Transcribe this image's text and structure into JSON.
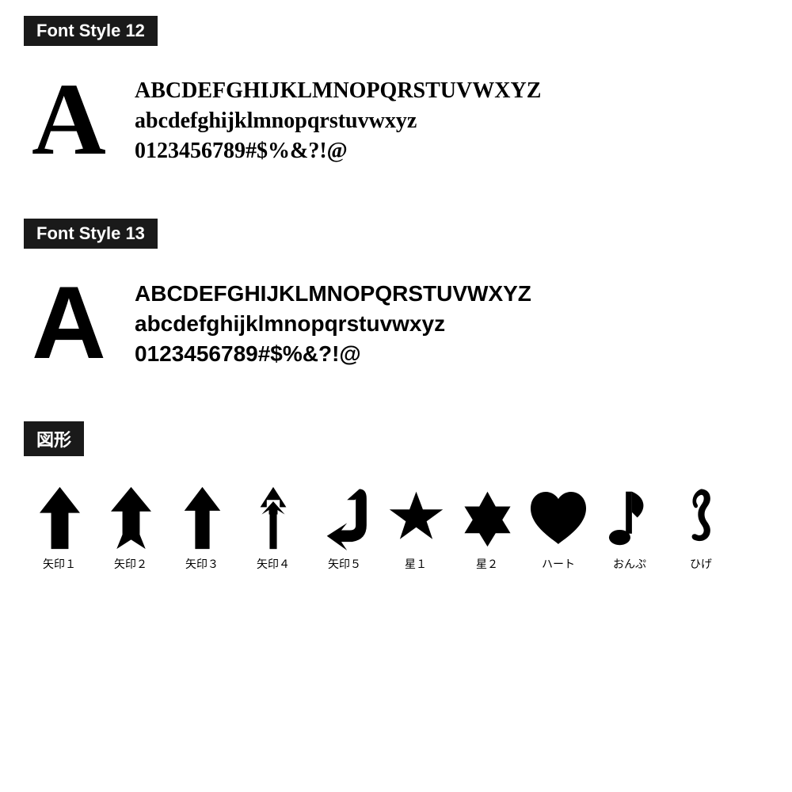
{
  "sections": [
    {
      "id": "font-style-12",
      "label": "Font Style 12",
      "bigLetter": "A",
      "lines": [
        "ABCDEFGHIJKLMNOPQRSTUVWXYZ",
        "abcdefghijklmnopqrstuvwxyz",
        "0123456789#$%&?!@"
      ],
      "fontClass": "font-style-12"
    },
    {
      "id": "font-style-13",
      "label": "Font Style 13",
      "bigLetter": "A",
      "lines": [
        "ABCDEFGHIJKLMNOPQRSTUVWXYZ",
        "abcdefghijklmnopqrstuvwxyz",
        "0123456789#$%&?!@"
      ],
      "fontClass": "font-style-13"
    }
  ],
  "figuresSection": {
    "label": "図形",
    "figures": [
      {
        "id": "arrow1",
        "label": "矢印１",
        "type": "arrow1"
      },
      {
        "id": "arrow2",
        "label": "矢印２",
        "type": "arrow2"
      },
      {
        "id": "arrow3",
        "label": "矢印３",
        "type": "arrow3"
      },
      {
        "id": "arrow4",
        "label": "矢印４",
        "type": "arrow4"
      },
      {
        "id": "arrow5",
        "label": "矢印５",
        "type": "arrow5"
      },
      {
        "id": "star1",
        "label": "星１",
        "type": "star1"
      },
      {
        "id": "star2",
        "label": "星２",
        "type": "star2"
      },
      {
        "id": "heart",
        "label": "ハート",
        "type": "heart"
      },
      {
        "id": "note",
        "label": "おんぷ",
        "type": "note"
      },
      {
        "id": "mustache",
        "label": "ひげ",
        "type": "mustache"
      }
    ]
  }
}
